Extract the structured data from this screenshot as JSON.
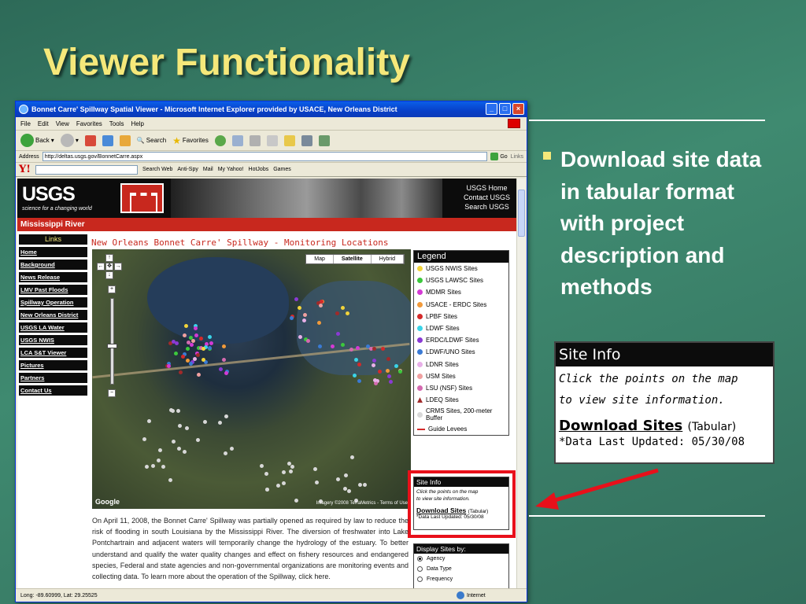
{
  "slide": {
    "title": "Viewer Functionality",
    "bullet": "Download site data in tabular format with project description and methods"
  },
  "browser": {
    "title": "Bonnet Carre' Spillway Spatial Viewer - Microsoft Internet Explorer provided by USACE, New Orleans District",
    "menu": [
      "File",
      "Edit",
      "View",
      "Favorites",
      "Tools",
      "Help"
    ],
    "toolbar": {
      "back": "Back",
      "search": "Search",
      "favorites": "Favorites"
    },
    "address_label": "Address",
    "address_value": "http://deltas.usgs.gov/BonnetCarre.aspx",
    "go": "Go",
    "links": "Links",
    "yahoo": {
      "search_web": "Search Web",
      "anti_spy": "Anti-Spy",
      "mail": "Mail",
      "my_yahoo": "My Yahoo!",
      "hotjobs": "HotJobs",
      "games": "Games"
    },
    "status": "Long: -89.60999, Lat: 29.25525",
    "zone": "Internet"
  },
  "site": {
    "logo": "USGS",
    "tagline": "science for a changing world",
    "header_links": [
      "USGS Home",
      "Contact USGS",
      "Search USGS"
    ],
    "section": "Mississippi River",
    "nav_head": "Links",
    "nav": [
      "Home",
      "Background",
      "News Release",
      "LMV Past Floods",
      "Spillway Operation",
      "New Orleans District",
      "USGS LA Water",
      "USGS NWIS",
      "LCA S&T Viewer",
      "Pictures",
      "Partners",
      "Contact Us"
    ],
    "map_title": "New Orleans Bonnet Carre' Spillway - Monitoring Locations",
    "map_types": [
      "Map",
      "Satellite",
      "Hybrid"
    ],
    "map_copyright": "Imagery ©2008 TerraMetrics - Terms of Use",
    "google": "Google",
    "legend_head": "Legend",
    "legend": [
      {
        "label": "USGS NWIS Sites",
        "color": "#f2d43a"
      },
      {
        "label": "USGS LAWSC Sites",
        "color": "#3cc83c"
      },
      {
        "label": "MDMR Sites",
        "color": "#d43ad4"
      },
      {
        "label": "USACE - ERDC Sites",
        "color": "#f29a3a"
      },
      {
        "label": "LPBF Sites",
        "color": "#d42a2a"
      },
      {
        "label": "LDWF Sites",
        "color": "#3ad4e8"
      },
      {
        "label": "ERDC/LDWF Sites",
        "color": "#8a3ad4"
      },
      {
        "label": "LDWF/UNO Sites",
        "color": "#3a7ad4"
      },
      {
        "label": "LDNR Sites",
        "color": "#e8b0e8"
      },
      {
        "label": "USM Sites",
        "color": "#f0a0a0"
      },
      {
        "label": "LSU (NSF) Sites",
        "color": "#d46ab0"
      },
      {
        "label": "LDEQ Sites",
        "color": "#a02a2a"
      },
      {
        "label": "CRMS Sites, 200-meter Buffer",
        "color": "#d8d8d8"
      },
      {
        "label": "Guide Levees",
        "color": "#d42a2a"
      }
    ],
    "site_info": {
      "head": "Site Info",
      "instruction_1": "Click the points on the map",
      "instruction_2": "to view site information.",
      "download": "Download Sites",
      "tabular": "(Tabular)",
      "updated": "*Data Last Updated: 05/30/08"
    },
    "display_sites": {
      "head": "Display Sites by:",
      "options": [
        "Agency",
        "Data Type",
        "Frequency"
      ],
      "selected": "Agency"
    },
    "body": "On April 11, 2008, the Bonnet Carre' Spillway was partially opened as required by law to reduce the risk of flooding in south Louisiana by the Mississippi River. The diversion of freshwater into Lake Pontchartrain and adjacent waters will temporarily change the hydrology of the estuary. To better understand and qualify the water quality changes and effect on fishery resources and endangered species, Federal and state agencies and non-governmental organizations are monitoring events and collecting data. To learn more about the operation of the Spillway, click here."
  }
}
